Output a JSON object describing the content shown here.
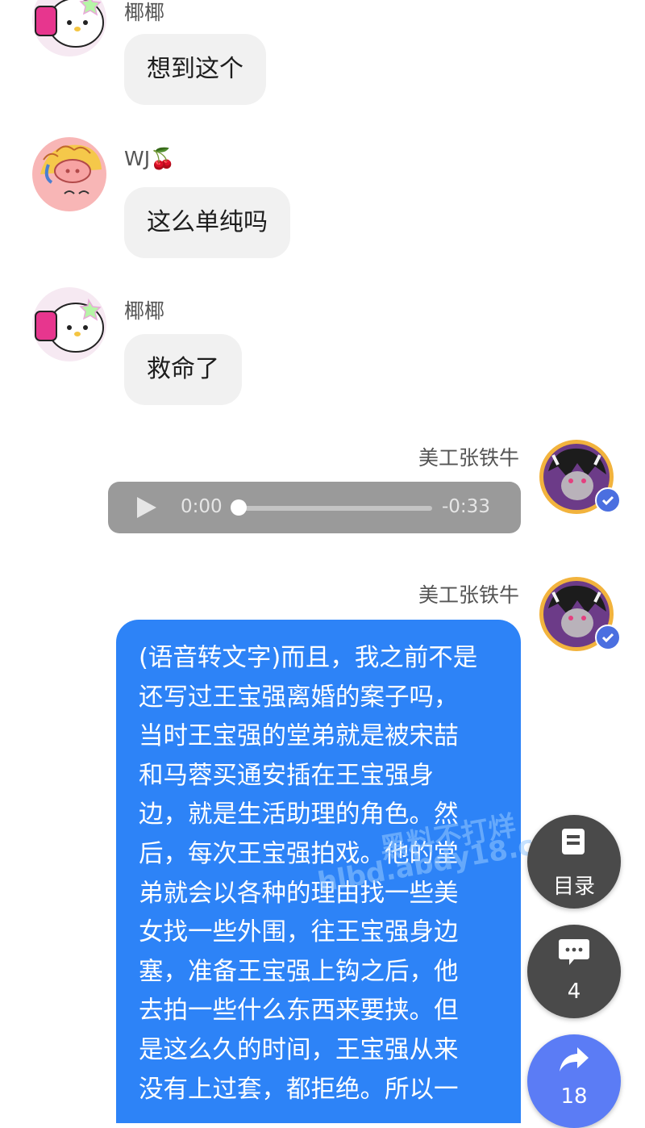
{
  "messages": [
    {
      "side": "left",
      "user": "椰椰",
      "text": "想到这个"
    },
    {
      "side": "left",
      "user": "WJ🍒",
      "text": "这么单纯吗"
    },
    {
      "side": "left",
      "user": "椰椰",
      "text": "救命了"
    },
    {
      "side": "right",
      "user": "美工张铁牛",
      "type": "voice",
      "elapsed": "0:00",
      "remaining": "-0:33",
      "progress": 0.0
    },
    {
      "side": "right",
      "user": "美工张铁牛",
      "type": "text",
      "lines": [
        "(语音转文字)而且，我之前不是",
        "还写过王宝强离婚的案子吗，",
        "当时王宝强的堂弟就是被宋喆",
        "和马蓉买通安插在王宝强身",
        "边，就是生活助理的角色。然",
        "后，每次王宝强拍戏。他的堂",
        "弟就会以各种的理由找一些美",
        "女找一些外围，往王宝强身边",
        "塞，准备王宝强上钩之后，他",
        "去拍一些什么东西来要挟。但",
        "是这么久的时间，王宝强从来",
        "没有上过套，都拒绝。所以一"
      ]
    }
  ],
  "floating_actions": {
    "toc": {
      "label": "目录",
      "icon": "document-icon"
    },
    "comments": {
      "count": "4",
      "icon": "comment-icon"
    },
    "share": {
      "label": "18",
      "icon": "share-icon"
    }
  },
  "watermark": {
    "line1": "黑料不打烊",
    "line2": "hlbd.abdy18.com"
  },
  "colors": {
    "bubble_left": "#f1f1f1",
    "bubble_blue": "#2d83f7",
    "audio_bg": "#9a9a9a",
    "fab_bg": "#4a4a4a",
    "share_bg": "#5b7cf5"
  }
}
